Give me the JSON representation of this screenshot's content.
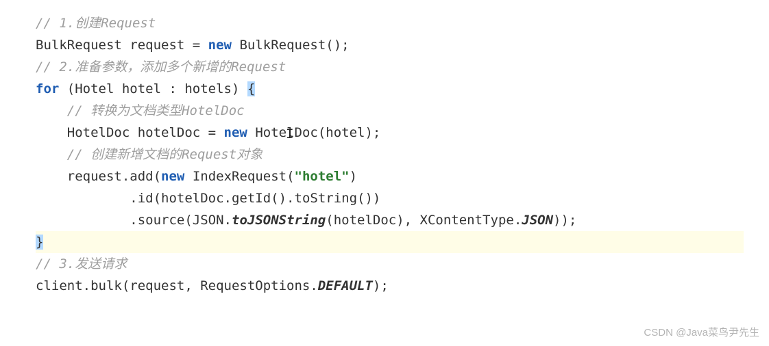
{
  "code": {
    "c1": "// 1.创建Request",
    "l2_a": "BulkRequest request = ",
    "l2_kw": "new",
    "l2_b": " BulkRequest();",
    "c2": "// 2.准备参数，添加多个新增的Request",
    "l4_kw": "for",
    "l4_a": " (Hotel hotel : hotels) ",
    "l4_brace": "{",
    "c3": "// 转换为文档类型HotelDoc",
    "l6_a": "HotelDoc hotelDoc = ",
    "l6_kw": "new",
    "l6_b": " Hote",
    "l6_c": "Doc(hotel);",
    "c4": "// 创建新增文档的Request对象",
    "l8_a": "request.add(",
    "l8_kw": "new",
    "l8_b": " IndexRequest(",
    "l8_str": "\"hotel\"",
    "l8_c": ")",
    "l9": ".id(hotelDoc.getId().toString())",
    "l10_a": ".source(JSON.",
    "l10_i": "toJSONString",
    "l10_b": "(hotelDoc), XContentType.",
    "l10_j": "JSON",
    "l10_c": "));",
    "l11_brace": "}",
    "c5": "// 3.发送请求",
    "l13_a": "client.bulk(request, RequestOptions.",
    "l13_i": "DEFAULT",
    "l13_b": ");"
  },
  "watermark": "CSDN @Java菜鸟尹先生"
}
